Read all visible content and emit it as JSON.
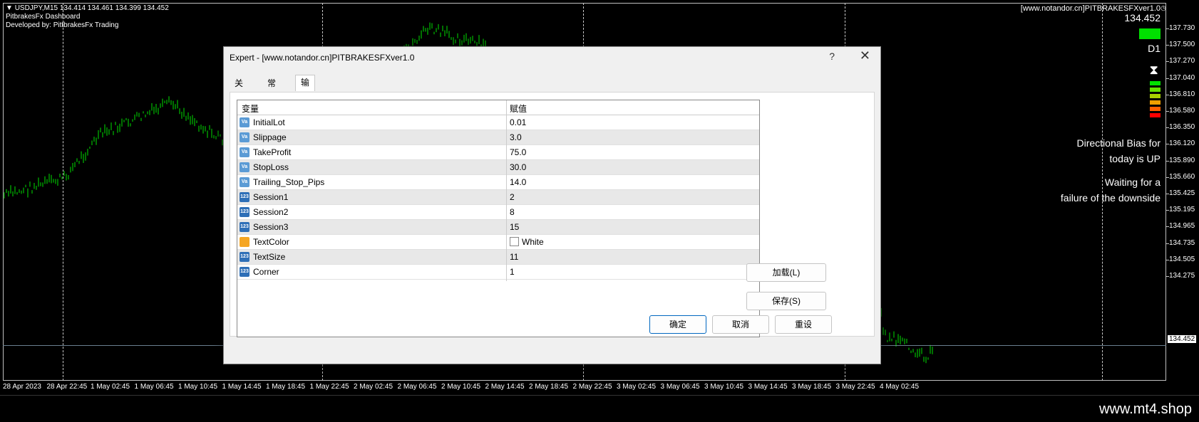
{
  "chart": {
    "info_line1": "USDJPY,M15  134.414 134.461 134.399 134.452",
    "info_line2": "PitbrakesFx Dashboard",
    "info_line3": "Developed by: PittbrakesFx Trading",
    "price_levels": [
      "137.730",
      "137.500",
      "137.270",
      "137.040",
      "136.810",
      "136.580",
      "136.350",
      "136.120",
      "135.890",
      "135.660",
      "135.425",
      "135.195",
      "134.965",
      "134.735",
      "134.505",
      "134.275"
    ],
    "current_price": "134.452",
    "time_labels": [
      "28 Apr 2023",
      "28 Apr 22:45",
      "1 May 02:45",
      "1 May 06:45",
      "1 May 10:45",
      "1 May 14:45",
      "1 May 18:45",
      "1 May 22:45",
      "2 May 02:45",
      "2 May 06:45",
      "2 May 10:45",
      "2 May 14:45",
      "2 May 18:45",
      "2 May 22:45",
      "3 May 02:45",
      "3 May 06:45",
      "3 May 10:45",
      "3 May 14:45",
      "3 May 18:45",
      "3 May 22:45",
      "4 May 02:45"
    ],
    "candle_color": "#00e000",
    "background": "#000000"
  },
  "dashboard": {
    "title": "[www.notandor.cn]PITBRAKESFXver1.0",
    "price": "134.452",
    "timeframe": "D1",
    "bias_line1": "Directional Bias for",
    "bias_line2": "today is UP",
    "wait_line1": "Waiting for a",
    "wait_line2": "failure of the downside",
    "strength_colors": [
      "#00e000",
      "#66e000",
      "#a8d000",
      "#f0a000",
      "#ff6000",
      "#ff0000"
    ]
  },
  "dialog": {
    "title": "Expert - [www.notandor.cn]PITBRAKESFXver1.0",
    "help": "?",
    "close": "✕",
    "tabs": [
      "关于",
      "常用",
      "输入参数"
    ],
    "active_tab": "输入参数",
    "col_variable": "变量",
    "col_value": "赋值",
    "params": [
      {
        "icon": "Va",
        "name": "InitialLot",
        "value": "0.01"
      },
      {
        "icon": "Va",
        "name": "Slippage",
        "value": "3.0"
      },
      {
        "icon": "Va",
        "name": "TakeProfit",
        "value": "75.0"
      },
      {
        "icon": "Va",
        "name": "StopLoss",
        "value": "30.0"
      },
      {
        "icon": "Va",
        "name": "Trailing_Stop_Pips",
        "value": "14.0"
      },
      {
        "icon": "123",
        "name": "Session1",
        "value": "2"
      },
      {
        "icon": "123",
        "name": "Session2",
        "value": "8"
      },
      {
        "icon": "123",
        "name": "Session3",
        "value": "15"
      },
      {
        "icon": "clr",
        "name": "TextColor",
        "value": "White"
      },
      {
        "icon": "123",
        "name": "TextSize",
        "value": "11"
      },
      {
        "icon": "123",
        "name": "Corner",
        "value": "1"
      }
    ],
    "btn_load": "加载(L)",
    "btn_save": "保存(S)",
    "btn_ok": "确定",
    "btn_cancel": "取消",
    "btn_reset": "重设"
  },
  "footer": {
    "brand": "www.mt4.shop"
  }
}
